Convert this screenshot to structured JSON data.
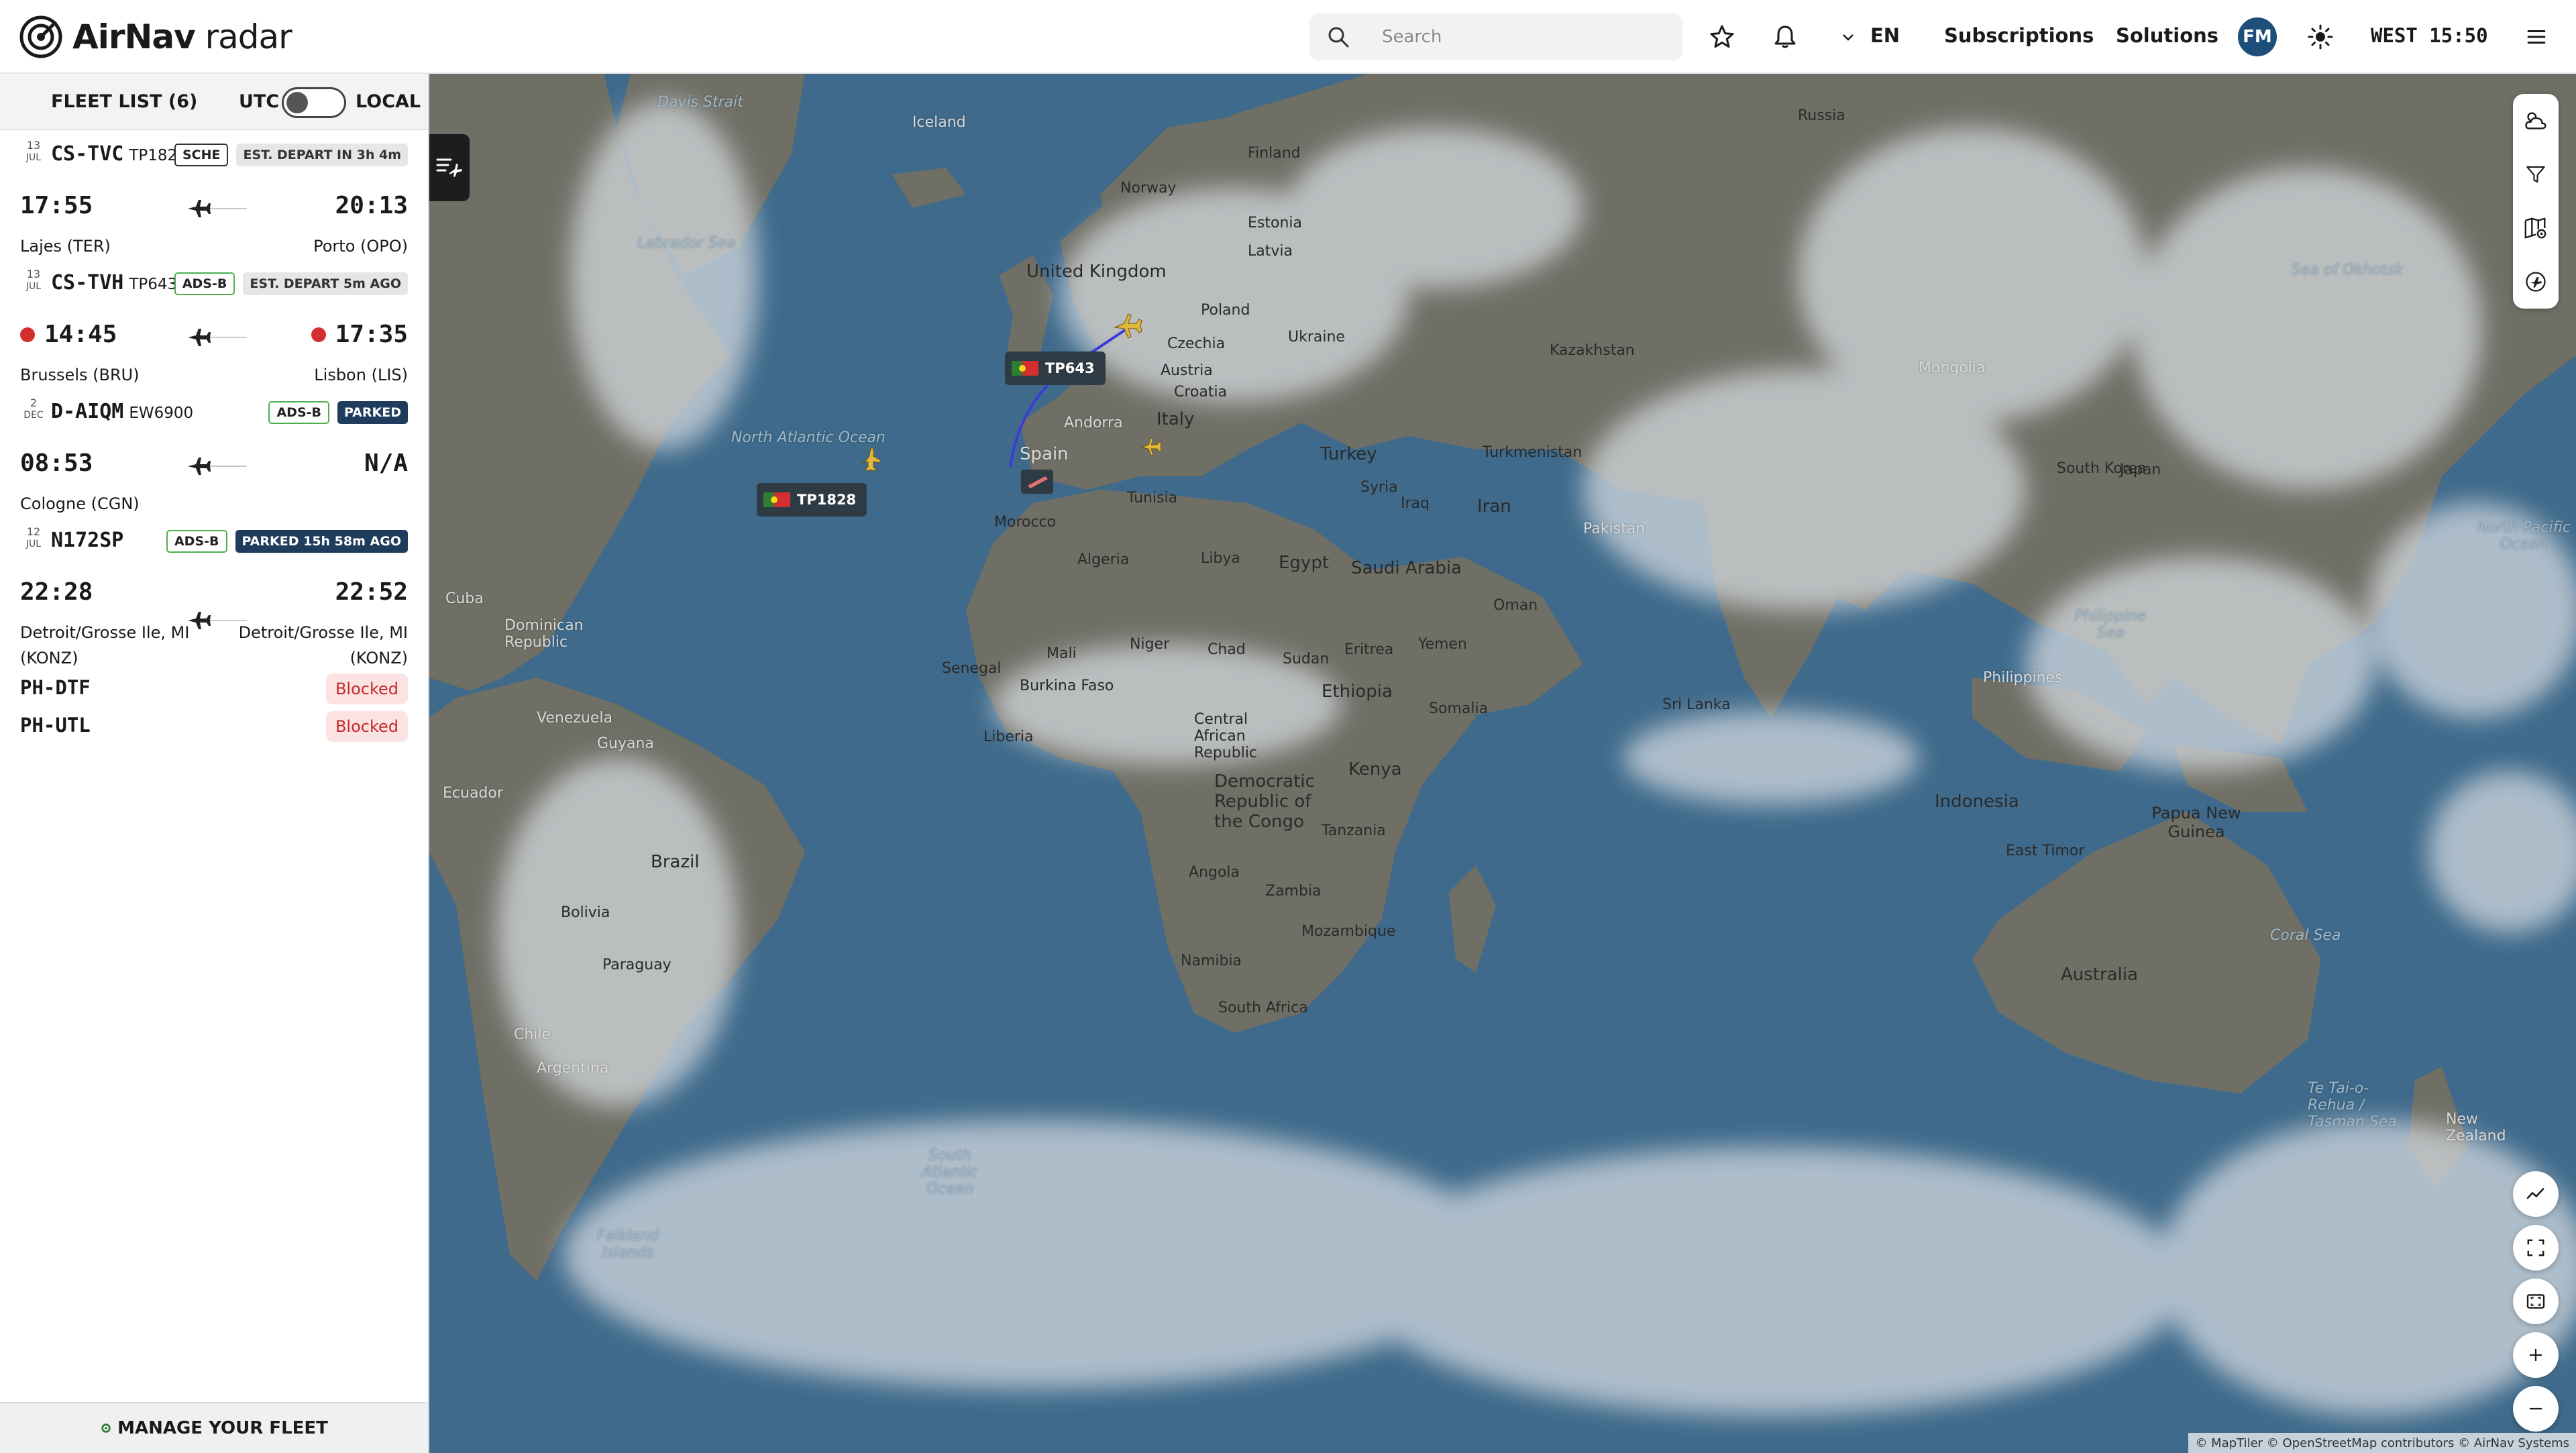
{
  "header": {
    "brand_bold": "AirNav",
    "brand_light": "radar",
    "search_placeholder": "Search",
    "language": "EN",
    "nav": [
      "Subscriptions",
      "Solutions"
    ],
    "avatar_initials": "FM",
    "clock": "WEST 15:50",
    "icons": [
      "search-icon",
      "star-icon",
      "bell-icon",
      "chevron-down-icon",
      "sun-icon",
      "menu-icon"
    ]
  },
  "sidebar": {
    "title": "FLEET LIST (6)",
    "utc_label": "UTC",
    "local_label": "LOCAL",
    "flights": [
      {
        "day": "13",
        "month": "JUL",
        "registration": "CS-TVC",
        "flight_number": "TP1828",
        "badges": [
          {
            "text": "SCHE",
            "style": "outline"
          },
          {
            "text": "EST. DEPART IN 3h 4m",
            "style": "grey"
          }
        ],
        "dep_time": "17:55",
        "arr_time": "20:13",
        "live_dep": false,
        "live_arr": false,
        "dep_city": "Lajes (TER)",
        "arr_city": "Porto (OPO)"
      },
      {
        "day": "13",
        "month": "JUL",
        "registration": "CS-TVH",
        "flight_number": "TP643",
        "badges": [
          {
            "text": "ADS-B",
            "style": "outline-green"
          },
          {
            "text": "EST. DEPART 5m AGO",
            "style": "grey"
          }
        ],
        "dep_time": "14:45",
        "arr_time": "17:35",
        "live_dep": true,
        "live_arr": true,
        "dep_city": "Brussels (BRU)",
        "arr_city": "Lisbon (LIS)"
      },
      {
        "day": "2",
        "month": "DEC",
        "registration": "D-AIQM",
        "flight_number": "EW6900",
        "badges": [
          {
            "text": "ADS-B",
            "style": "outline-green"
          },
          {
            "text": "PARKED",
            "style": "navy"
          }
        ],
        "dep_time": "08:53",
        "arr_time": "N/A",
        "live_dep": false,
        "live_arr": false,
        "dep_city": "Cologne (CGN)",
        "arr_city": ""
      },
      {
        "day": "12",
        "month": "JUL",
        "registration": "N172SP",
        "flight_number": "",
        "badges": [
          {
            "text": "ADS-B",
            "style": "outline-green"
          },
          {
            "text": "PARKED 15h 58m AGO",
            "style": "navy"
          }
        ],
        "dep_time": "22:28",
        "arr_time": "22:52",
        "live_dep": false,
        "live_arr": false,
        "dep_city": "Detroit/Grosse Ile, MI (KONZ)",
        "arr_city": "Detroit/Grosse Ile, MI (KONZ)"
      }
    ],
    "blocked": [
      {
        "registration": "PH-DTF",
        "status": "Blocked"
      },
      {
        "registration": "PH-UTL",
        "status": "Blocked"
      }
    ],
    "manage_label": "MANAGE YOUR FLEET"
  },
  "map": {
    "flight_tags": [
      "TP643",
      "TP1828"
    ],
    "route_color": "#3b3bd6",
    "labels": [
      {
        "text": "Davis Strait",
        "kind": "ocean"
      },
      {
        "text": "Iceland",
        "kind": "land"
      },
      {
        "text": "Labrador Sea",
        "kind": "ocean"
      },
      {
        "text": "Finland",
        "kind": "land"
      },
      {
        "text": "Norway",
        "kind": "land"
      },
      {
        "text": "Estonia",
        "kind": "land"
      },
      {
        "text": "Latvia",
        "kind": "land"
      },
      {
        "text": "United Kingdom",
        "kind": "land"
      },
      {
        "text": "Poland",
        "kind": "land"
      },
      {
        "text": "Czechia",
        "kind": "land"
      },
      {
        "text": "Ukraine",
        "kind": "land"
      },
      {
        "text": "Austria",
        "kind": "land"
      },
      {
        "text": "Croatia",
        "kind": "land"
      },
      {
        "text": "Italy",
        "kind": "land"
      },
      {
        "text": "Spain",
        "kind": "land"
      },
      {
        "text": "Andorra",
        "kind": "land"
      },
      {
        "text": "Russia",
        "kind": "land"
      },
      {
        "text": "Kazakhstan",
        "kind": "land"
      },
      {
        "text": "Turkey",
        "kind": "land"
      },
      {
        "text": "Turkmenistan",
        "kind": "land"
      },
      {
        "text": "Syria",
        "kind": "land"
      },
      {
        "text": "Iraq",
        "kind": "land"
      },
      {
        "text": "Iran",
        "kind": "land"
      },
      {
        "text": "Pakistan",
        "kind": "land"
      },
      {
        "text": "Mongolia",
        "kind": "land"
      },
      {
        "text": "South Korea",
        "kind": "land"
      },
      {
        "text": "Japan",
        "kind": "land"
      },
      {
        "text": "Sea of Okhotsk",
        "kind": "ocean"
      },
      {
        "text": "North Atlantic Ocean",
        "kind": "ocean"
      },
      {
        "text": "Tunisia",
        "kind": "land"
      },
      {
        "text": "Morocco",
        "kind": "land"
      },
      {
        "text": "Algeria",
        "kind": "land"
      },
      {
        "text": "Libya",
        "kind": "land"
      },
      {
        "text": "Egypt",
        "kind": "land"
      },
      {
        "text": "Saudi Arabia",
        "kind": "land"
      },
      {
        "text": "Oman",
        "kind": "land"
      },
      {
        "text": "Yemen",
        "kind": "land"
      },
      {
        "text": "Eritrea",
        "kind": "land"
      },
      {
        "text": "Sudan",
        "kind": "land"
      },
      {
        "text": "Chad",
        "kind": "land"
      },
      {
        "text": "Niger",
        "kind": "land"
      },
      {
        "text": "Mali",
        "kind": "land"
      },
      {
        "text": "Senegal",
        "kind": "land"
      },
      {
        "text": "Burkina Faso",
        "kind": "land"
      },
      {
        "text": "Liberia",
        "kind": "land"
      },
      {
        "text": "Central African Republic",
        "kind": "land"
      },
      {
        "text": "Ethiopia",
        "kind": "land"
      },
      {
        "text": "Somalia",
        "kind": "land"
      },
      {
        "text": "Kenya",
        "kind": "land"
      },
      {
        "text": "Democratic Republic of the Congo",
        "kind": "land"
      },
      {
        "text": "Tanzania",
        "kind": "land"
      },
      {
        "text": "Angola",
        "kind": "land"
      },
      {
        "text": "Zambia",
        "kind": "land"
      },
      {
        "text": "Mozambique",
        "kind": "land"
      },
      {
        "text": "Namibia",
        "kind": "land"
      },
      {
        "text": "South Africa",
        "kind": "land"
      },
      {
        "text": "Cuba",
        "kind": "land"
      },
      {
        "text": "Dominican Republic",
        "kind": "land"
      },
      {
        "text": "Venezuela",
        "kind": "land"
      },
      {
        "text": "Guyana",
        "kind": "land"
      },
      {
        "text": "Ecuador",
        "kind": "land"
      },
      {
        "text": "Brazil",
        "kind": "land"
      },
      {
        "text": "Bolivia",
        "kind": "land"
      },
      {
        "text": "Paraguay",
        "kind": "land"
      },
      {
        "text": "Chile",
        "kind": "land"
      },
      {
        "text": "Argentina",
        "kind": "land"
      },
      {
        "text": "South Atlantic Ocean",
        "kind": "ocean"
      },
      {
        "text": "Falkland Islands",
        "kind": "land"
      },
      {
        "text": "Sri Lanka",
        "kind": "land"
      },
      {
        "text": "Philippine Sea",
        "kind": "ocean"
      },
      {
        "text": "Philippines",
        "kind": "land"
      },
      {
        "text": "Indonesia",
        "kind": "land"
      },
      {
        "text": "East Timor",
        "kind": "land"
      },
      {
        "text": "Papua New Guinea",
        "kind": "land"
      },
      {
        "text": "Coral Sea",
        "kind": "ocean"
      },
      {
        "text": "Australia",
        "kind": "land"
      },
      {
        "text": "North Pacific Ocean",
        "kind": "ocean"
      },
      {
        "text": "New Zealand",
        "kind": "land"
      },
      {
        "text": "Te Tai-o-Rehua / Tasman Sea",
        "kind": "ocean"
      }
    ],
    "attribution": "© MapTiler © OpenStreetMap contributors © AirNav Systems"
  },
  "colors": {
    "ocean": "#3f6a8b",
    "land": "#6f6f66",
    "navy_badge": "#1f3c5c",
    "live_dot": "#d32f2f",
    "blocked_bg": "#fbe3e3",
    "blocked_text": "#c62828",
    "avatar": "#1e4e7a"
  }
}
